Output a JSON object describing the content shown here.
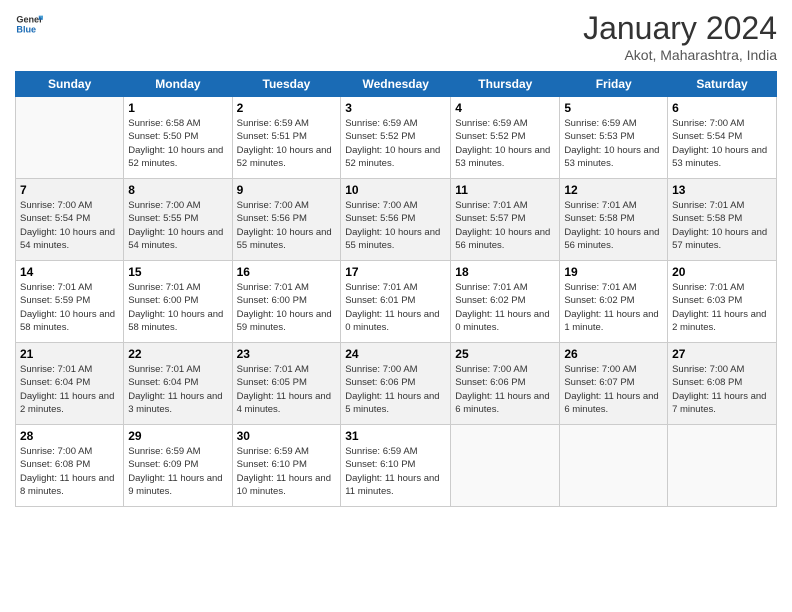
{
  "header": {
    "logo_general": "General",
    "logo_blue": "Blue",
    "title": "January 2024",
    "subtitle": "Akot, Maharashtra, India"
  },
  "days_of_week": [
    "Sunday",
    "Monday",
    "Tuesday",
    "Wednesday",
    "Thursday",
    "Friday",
    "Saturday"
  ],
  "weeks": [
    [
      {
        "day": "",
        "sunrise": "",
        "sunset": "",
        "daylight": ""
      },
      {
        "day": "1",
        "sunrise": "Sunrise: 6:58 AM",
        "sunset": "Sunset: 5:50 PM",
        "daylight": "Daylight: 10 hours and 52 minutes."
      },
      {
        "day": "2",
        "sunrise": "Sunrise: 6:59 AM",
        "sunset": "Sunset: 5:51 PM",
        "daylight": "Daylight: 10 hours and 52 minutes."
      },
      {
        "day": "3",
        "sunrise": "Sunrise: 6:59 AM",
        "sunset": "Sunset: 5:52 PM",
        "daylight": "Daylight: 10 hours and 52 minutes."
      },
      {
        "day": "4",
        "sunrise": "Sunrise: 6:59 AM",
        "sunset": "Sunset: 5:52 PM",
        "daylight": "Daylight: 10 hours and 53 minutes."
      },
      {
        "day": "5",
        "sunrise": "Sunrise: 6:59 AM",
        "sunset": "Sunset: 5:53 PM",
        "daylight": "Daylight: 10 hours and 53 minutes."
      },
      {
        "day": "6",
        "sunrise": "Sunrise: 7:00 AM",
        "sunset": "Sunset: 5:54 PM",
        "daylight": "Daylight: 10 hours and 53 minutes."
      }
    ],
    [
      {
        "day": "7",
        "sunrise": "Sunrise: 7:00 AM",
        "sunset": "Sunset: 5:54 PM",
        "daylight": "Daylight: 10 hours and 54 minutes."
      },
      {
        "day": "8",
        "sunrise": "Sunrise: 7:00 AM",
        "sunset": "Sunset: 5:55 PM",
        "daylight": "Daylight: 10 hours and 54 minutes."
      },
      {
        "day": "9",
        "sunrise": "Sunrise: 7:00 AM",
        "sunset": "Sunset: 5:56 PM",
        "daylight": "Daylight: 10 hours and 55 minutes."
      },
      {
        "day": "10",
        "sunrise": "Sunrise: 7:00 AM",
        "sunset": "Sunset: 5:56 PM",
        "daylight": "Daylight: 10 hours and 55 minutes."
      },
      {
        "day": "11",
        "sunrise": "Sunrise: 7:01 AM",
        "sunset": "Sunset: 5:57 PM",
        "daylight": "Daylight: 10 hours and 56 minutes."
      },
      {
        "day": "12",
        "sunrise": "Sunrise: 7:01 AM",
        "sunset": "Sunset: 5:58 PM",
        "daylight": "Daylight: 10 hours and 56 minutes."
      },
      {
        "day": "13",
        "sunrise": "Sunrise: 7:01 AM",
        "sunset": "Sunset: 5:58 PM",
        "daylight": "Daylight: 10 hours and 57 minutes."
      }
    ],
    [
      {
        "day": "14",
        "sunrise": "Sunrise: 7:01 AM",
        "sunset": "Sunset: 5:59 PM",
        "daylight": "Daylight: 10 hours and 58 minutes."
      },
      {
        "day": "15",
        "sunrise": "Sunrise: 7:01 AM",
        "sunset": "Sunset: 6:00 PM",
        "daylight": "Daylight: 10 hours and 58 minutes."
      },
      {
        "day": "16",
        "sunrise": "Sunrise: 7:01 AM",
        "sunset": "Sunset: 6:00 PM",
        "daylight": "Daylight: 10 hours and 59 minutes."
      },
      {
        "day": "17",
        "sunrise": "Sunrise: 7:01 AM",
        "sunset": "Sunset: 6:01 PM",
        "daylight": "Daylight: 11 hours and 0 minutes."
      },
      {
        "day": "18",
        "sunrise": "Sunrise: 7:01 AM",
        "sunset": "Sunset: 6:02 PM",
        "daylight": "Daylight: 11 hours and 0 minutes."
      },
      {
        "day": "19",
        "sunrise": "Sunrise: 7:01 AM",
        "sunset": "Sunset: 6:02 PM",
        "daylight": "Daylight: 11 hours and 1 minute."
      },
      {
        "day": "20",
        "sunrise": "Sunrise: 7:01 AM",
        "sunset": "Sunset: 6:03 PM",
        "daylight": "Daylight: 11 hours and 2 minutes."
      }
    ],
    [
      {
        "day": "21",
        "sunrise": "Sunrise: 7:01 AM",
        "sunset": "Sunset: 6:04 PM",
        "daylight": "Daylight: 11 hours and 2 minutes."
      },
      {
        "day": "22",
        "sunrise": "Sunrise: 7:01 AM",
        "sunset": "Sunset: 6:04 PM",
        "daylight": "Daylight: 11 hours and 3 minutes."
      },
      {
        "day": "23",
        "sunrise": "Sunrise: 7:01 AM",
        "sunset": "Sunset: 6:05 PM",
        "daylight": "Daylight: 11 hours and 4 minutes."
      },
      {
        "day": "24",
        "sunrise": "Sunrise: 7:00 AM",
        "sunset": "Sunset: 6:06 PM",
        "daylight": "Daylight: 11 hours and 5 minutes."
      },
      {
        "day": "25",
        "sunrise": "Sunrise: 7:00 AM",
        "sunset": "Sunset: 6:06 PM",
        "daylight": "Daylight: 11 hours and 6 minutes."
      },
      {
        "day": "26",
        "sunrise": "Sunrise: 7:00 AM",
        "sunset": "Sunset: 6:07 PM",
        "daylight": "Daylight: 11 hours and 6 minutes."
      },
      {
        "day": "27",
        "sunrise": "Sunrise: 7:00 AM",
        "sunset": "Sunset: 6:08 PM",
        "daylight": "Daylight: 11 hours and 7 minutes."
      }
    ],
    [
      {
        "day": "28",
        "sunrise": "Sunrise: 7:00 AM",
        "sunset": "Sunset: 6:08 PM",
        "daylight": "Daylight: 11 hours and 8 minutes."
      },
      {
        "day": "29",
        "sunrise": "Sunrise: 6:59 AM",
        "sunset": "Sunset: 6:09 PM",
        "daylight": "Daylight: 11 hours and 9 minutes."
      },
      {
        "day": "30",
        "sunrise": "Sunrise: 6:59 AM",
        "sunset": "Sunset: 6:10 PM",
        "daylight": "Daylight: 11 hours and 10 minutes."
      },
      {
        "day": "31",
        "sunrise": "Sunrise: 6:59 AM",
        "sunset": "Sunset: 6:10 PM",
        "daylight": "Daylight: 11 hours and 11 minutes."
      },
      {
        "day": "",
        "sunrise": "",
        "sunset": "",
        "daylight": ""
      },
      {
        "day": "",
        "sunrise": "",
        "sunset": "",
        "daylight": ""
      },
      {
        "day": "",
        "sunrise": "",
        "sunset": "",
        "daylight": ""
      }
    ]
  ]
}
